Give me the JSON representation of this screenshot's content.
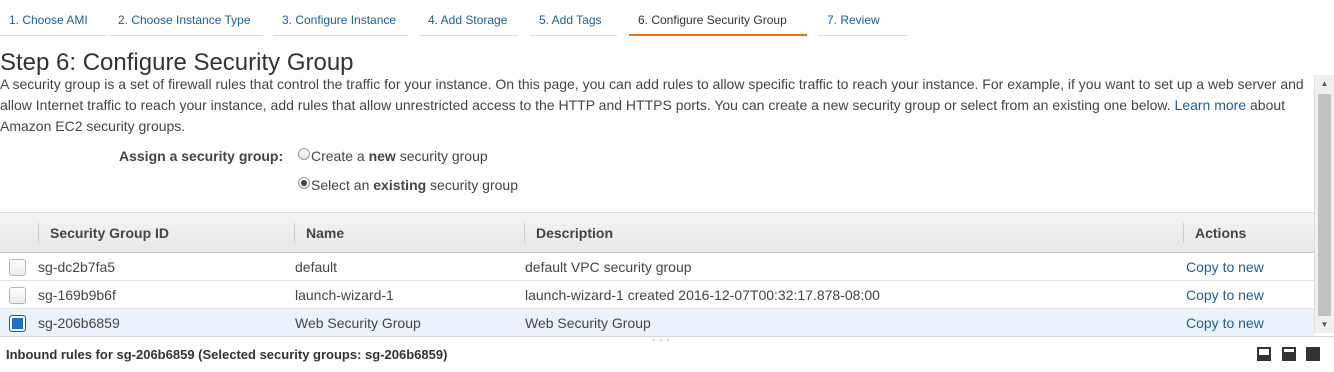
{
  "wizard": {
    "steps": [
      {
        "label": "1. Choose AMI"
      },
      {
        "label": "2. Choose Instance Type"
      },
      {
        "label": "3. Configure Instance"
      },
      {
        "label": "4. Add Storage"
      },
      {
        "label": "5. Add Tags"
      },
      {
        "label": "6. Configure Security Group",
        "active": true
      },
      {
        "label": "7. Review"
      }
    ],
    "active_color": "#ec7211"
  },
  "page": {
    "title": "Step 6: Configure Security Group",
    "intro": "A security group is a set of firewall rules that control the traffic for your instance. On this page, you can add rules to allow specific traffic to reach your instance. For example, if you want to set up a web server and allow Internet traffic to reach your instance, add rules that allow unrestricted access to the HTTP and HTTPS ports. You can create a new security group or select from an existing one below.",
    "learn_more_link": "Learn more",
    "intro_tail": "about Amazon EC2 security groups."
  },
  "assign": {
    "label": "Assign a security group:",
    "option_new": {
      "prefix": "Create a ",
      "bold": "new",
      "suffix": " security group",
      "checked": false
    },
    "option_existing": {
      "prefix": "Select an ",
      "bold": "existing",
      "suffix": " security group",
      "checked": true
    }
  },
  "table": {
    "columns": [
      "Security Group ID",
      "Name",
      "Description",
      "Actions"
    ],
    "rows": [
      {
        "id": "sg-dc2b7fa5",
        "name": "default",
        "description": "default VPC security group",
        "action": "Copy to new",
        "selected": false
      },
      {
        "id": "sg-169b9b6f",
        "name": "launch-wizard-1",
        "description": "launch-wizard-1 created 2016-12-07T00:32:17.878-08:00",
        "action": "Copy to new",
        "selected": false
      },
      {
        "id": "sg-206b6859",
        "name": "Web Security Group",
        "description": "Web Security Group",
        "action": "Copy to new",
        "selected": true
      }
    ]
  },
  "bottom": {
    "inbound_text": "Inbound rules for sg-206b6859 (Selected security groups: sg-206b6859)",
    "grip": "◦◦◦"
  },
  "scrollbar": {
    "up": "▲",
    "down": "▼"
  }
}
